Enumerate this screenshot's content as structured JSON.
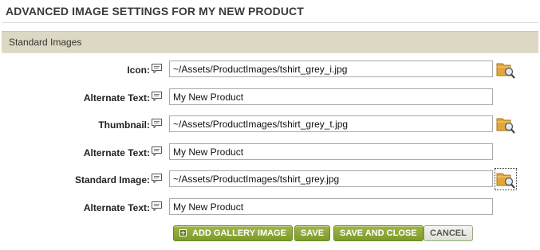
{
  "page": {
    "title": "ADVANCED IMAGE SETTINGS FOR MY NEW PRODUCT"
  },
  "section": {
    "title": "Standard Images"
  },
  "fields": {
    "icon": {
      "label": "Icon:",
      "value": "~/Assets/ProductImages/tshirt_grey_i.jpg"
    },
    "icon_alt": {
      "label": "Alternate Text:",
      "value": "My New Product"
    },
    "thumbnail": {
      "label": "Thumbnail:",
      "value": "~/Assets/ProductImages/tshirt_grey_t.jpg"
    },
    "thumbnail_alt": {
      "label": "Alternate Text:",
      "value": "My New Product"
    },
    "standard": {
      "label": "Standard Image:",
      "value": "~/Assets/ProductImages/tshirt_grey.jpg"
    },
    "standard_alt": {
      "label": "Alternate Text:",
      "value": "My New Product"
    }
  },
  "buttons": {
    "add_gallery": "ADD GALLERY IMAGE",
    "save": "SAVE",
    "save_close": "SAVE AND CLOSE",
    "cancel": "CANCEL"
  },
  "icons": {
    "help": "comment-help-icon",
    "browse": "folder-search-icon",
    "add": "plus-box-icon"
  },
  "colors": {
    "section_bg": "#dcd8c4",
    "button_green": "#8aa635",
    "button_grey": "#e6e6e0"
  }
}
